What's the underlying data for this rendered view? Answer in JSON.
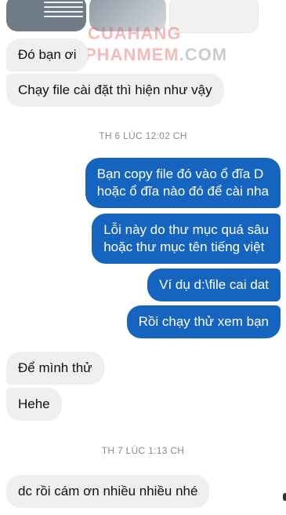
{
  "watermark": {
    "line1": "CUAHANG",
    "line2": "PHANMEM",
    "line2_suffix": ".COM"
  },
  "conversation": {
    "groups": [
      {
        "messages": [
          {
            "direction": "incoming",
            "text": "Đó bạn ơi"
          },
          {
            "direction": "incoming",
            "text": "Chạy file cài đặt thì hiện như vậy"
          }
        ]
      },
      {
        "timestamp": "TH 6 LÚC 12:02 CH",
        "messages": [
          {
            "direction": "outgoing",
            "lines": [
              "Bạn copy file đó vào ổ đĩa D",
              "hoặc ổ đĩa nào đó để cài nha"
            ]
          },
          {
            "direction": "outgoing",
            "lines": [
              "Lỗi này do thư mục quá sâu",
              "hoặc thư mục tên tiếng việt"
            ]
          },
          {
            "direction": "outgoing",
            "text": "Ví dụ d:\\file cai dat"
          },
          {
            "direction": "outgoing",
            "text": "Rồi chạy thử xem bạn"
          },
          {
            "direction": "incoming",
            "text": "Để mình thử"
          },
          {
            "direction": "incoming",
            "text": "Hehe"
          }
        ]
      },
      {
        "timestamp": "TH 7 LÚC 1:13 CH",
        "messages": [
          {
            "direction": "incoming",
            "text": "dc rồi cám ơn  nhiều nhiều  nhé"
          }
        ]
      }
    ]
  },
  "colors": {
    "outgoing_bubble": "#1565c0",
    "incoming_bubble": "#efefef",
    "timestamp": "#8a8a8a"
  }
}
